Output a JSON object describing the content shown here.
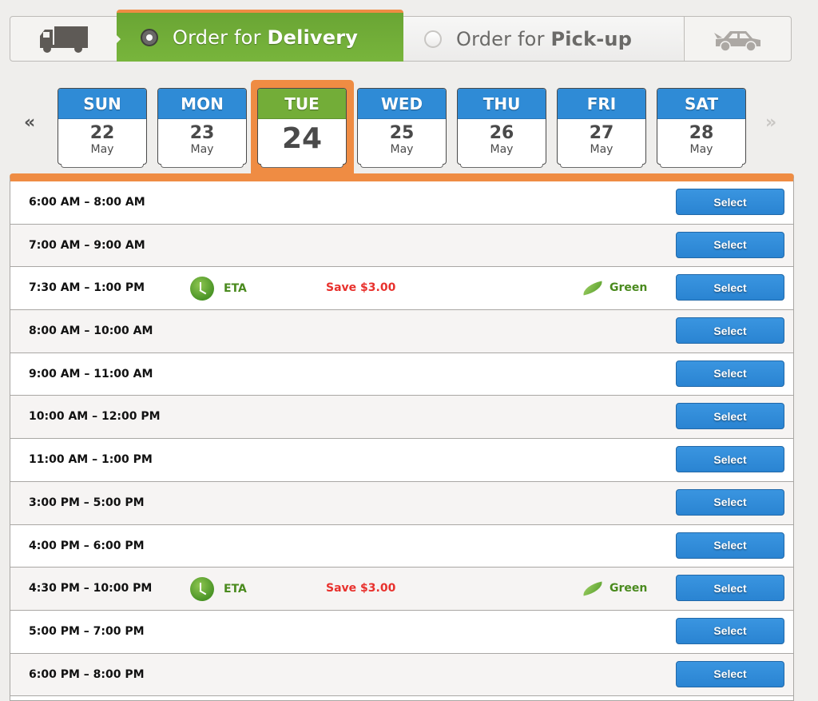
{
  "mode": {
    "delivery": {
      "prefix": "Order for ",
      "bold": "Delivery",
      "selected": true,
      "icon": "truck-icon"
    },
    "pickup": {
      "prefix": "Order for ",
      "bold": "Pick-up",
      "selected": false,
      "icon": "car-icon"
    }
  },
  "date_nav": {
    "prev": "«",
    "next": "»",
    "days": [
      {
        "dow": "SUN",
        "day": "22",
        "month": "May",
        "selected": false
      },
      {
        "dow": "MON",
        "day": "23",
        "month": "May",
        "selected": false
      },
      {
        "dow": "TUE",
        "day": "24",
        "month": "",
        "selected": true
      },
      {
        "dow": "WED",
        "day": "25",
        "month": "May",
        "selected": false
      },
      {
        "dow": "THU",
        "day": "26",
        "month": "May",
        "selected": false
      },
      {
        "dow": "FRI",
        "day": "27",
        "month": "May",
        "selected": false
      },
      {
        "dow": "SAT",
        "day": "28",
        "month": "May",
        "selected": false
      }
    ]
  },
  "slots": [
    {
      "time": "6:00 AM – 8:00 AM",
      "eta": "",
      "save": "",
      "green": "",
      "button": "Select"
    },
    {
      "time": "7:00 AM – 9:00 AM",
      "eta": "",
      "save": "",
      "green": "",
      "button": "Select"
    },
    {
      "time": "7:30 AM – 1:00 PM",
      "eta": "ETA",
      "save": "Save $3.00",
      "green": "Green",
      "button": "Select"
    },
    {
      "time": "8:00 AM – 10:00 AM",
      "eta": "",
      "save": "",
      "green": "",
      "button": "Select"
    },
    {
      "time": "9:00 AM – 11:00 AM",
      "eta": "",
      "save": "",
      "green": "",
      "button": "Select"
    },
    {
      "time": "10:00 AM – 12:00 PM",
      "eta": "",
      "save": "",
      "green": "",
      "button": "Select"
    },
    {
      "time": "11:00 AM – 1:00 PM",
      "eta": "",
      "save": "",
      "green": "",
      "button": "Select"
    },
    {
      "time": "3:00 PM – 5:00 PM",
      "eta": "",
      "save": "",
      "green": "",
      "button": "Select"
    },
    {
      "time": "4:00 PM – 6:00 PM",
      "eta": "",
      "save": "",
      "green": "",
      "button": "Select"
    },
    {
      "time": "4:30 PM – 10:00 PM",
      "eta": "ETA",
      "save": "Save $3.00",
      "green": "Green",
      "button": "Select"
    },
    {
      "time": "5:00 PM – 7:00 PM",
      "eta": "",
      "save": "",
      "green": "",
      "button": "Select"
    },
    {
      "time": "6:00 PM – 8:00 PM",
      "eta": "",
      "save": "",
      "green": "",
      "button": "Select"
    }
  ],
  "colors": {
    "accent_orange": "#ef8c43",
    "selected_green": "#73ad38",
    "day_blue": "#2f8bd6",
    "save_red": "#e8312d",
    "eta_green": "#4a8a1e"
  }
}
